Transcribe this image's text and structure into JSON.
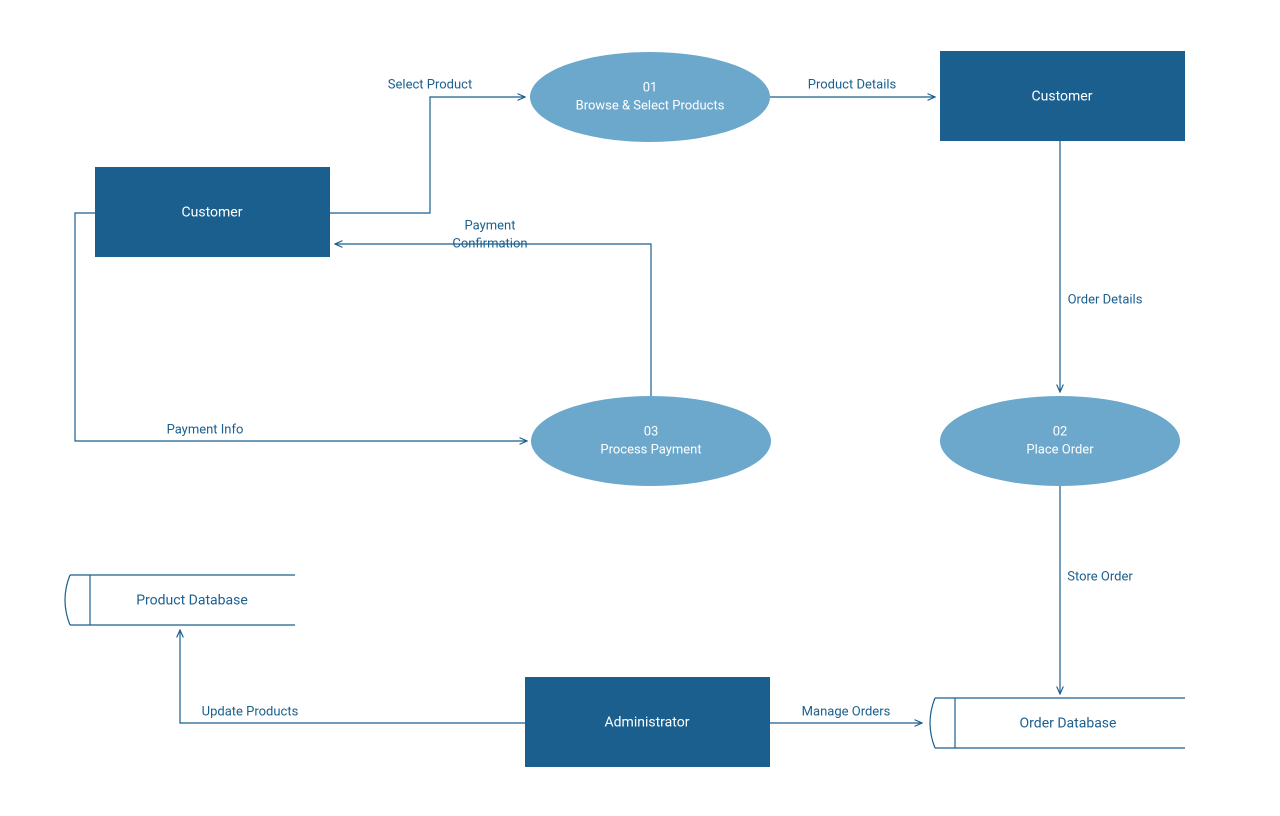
{
  "entities": {
    "customer_left": "Customer",
    "customer_right": "Customer",
    "administrator": "Administrator"
  },
  "processes": {
    "p01": {
      "num": "01",
      "name": "Browse & Select Products"
    },
    "p02": {
      "num": "02",
      "name": "Place Order"
    },
    "p03": {
      "num": "03",
      "name": "Process Payment"
    }
  },
  "datastores": {
    "product_db": "Product Database",
    "order_db": "Order Database"
  },
  "flows": {
    "select_product": "Select Product",
    "product_details": "Product Details",
    "order_details": "Order Details",
    "store_order": "Store Order",
    "manage_orders": "Manage Orders",
    "update_products": "Update Products",
    "payment_info": "Payment Info",
    "payment_confirmation_l1": "Payment",
    "payment_confirmation_l2": "Confirmation"
  }
}
